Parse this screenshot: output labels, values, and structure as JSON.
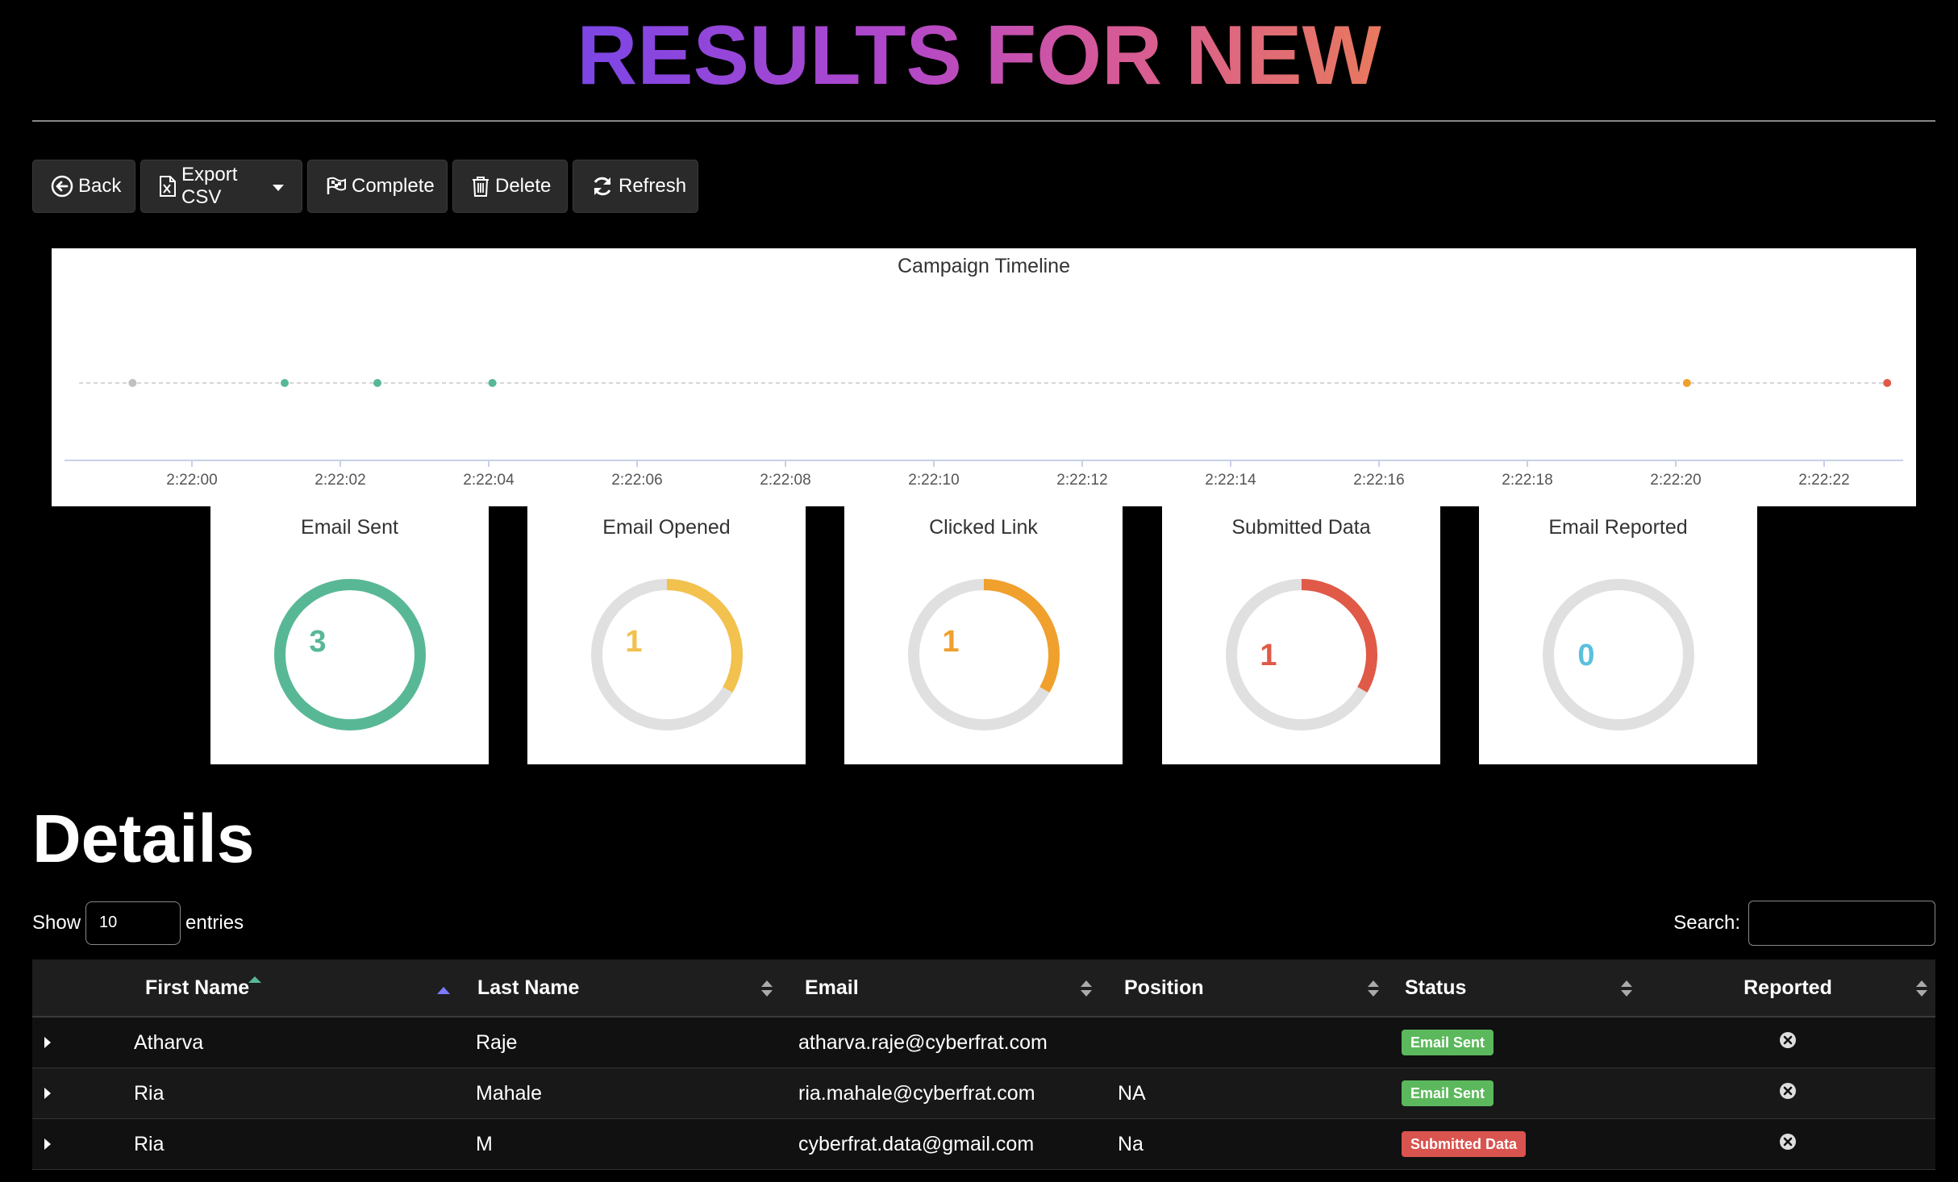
{
  "page": {
    "title": "RESULTS FOR NEW"
  },
  "toolbar": {
    "back_label": "Back",
    "export_label": "Export CSV",
    "complete_label": "Complete",
    "delete_label": "Delete",
    "refresh_label": "Refresh"
  },
  "timeline": {
    "title": "Campaign Timeline",
    "ticks": [
      "2:22:00",
      "2:22:02",
      "2:22:04",
      "2:22:06",
      "2:22:08",
      "2:22:10",
      "2:22:12",
      "2:22:14",
      "2:22:16",
      "2:22:18",
      "2:22:20",
      "2:22:22"
    ],
    "events": [
      {
        "t": -0.8,
        "color": "#c0c0c0"
      },
      {
        "t": 1.25,
        "color": "#58b896"
      },
      {
        "t": 2.5,
        "color": "#58b896"
      },
      {
        "t": 4.05,
        "color": "#58b896"
      },
      {
        "t": 20.15,
        "color": "#f0a02d"
      },
      {
        "t": 22.85,
        "color": "#e05a47"
      }
    ]
  },
  "stats": [
    {
      "label": "Email Sent",
      "value": "3",
      "fraction": 1.0,
      "color": "#58b896"
    },
    {
      "label": "Email Opened",
      "value": "1",
      "fraction": 0.333,
      "color": "#f2c14e"
    },
    {
      "label": "Clicked Link",
      "value": "1",
      "fraction": 0.333,
      "color": "#f0a02d"
    },
    {
      "label": "Submitted Data",
      "value": "1",
      "fraction": 0.333,
      "color": "#e05a47"
    },
    {
      "label": "Email Reported",
      "value": "0",
      "fraction": 0.0,
      "color": "#5bc0de"
    }
  ],
  "details": {
    "heading": "Details",
    "show_label": "Show",
    "entries_value": "10",
    "entries_label": "entries",
    "search_label": "Search:"
  },
  "table": {
    "headers": {
      "first_name": "First Name",
      "last_name": "Last Name",
      "email": "Email",
      "position": "Position",
      "status": "Status",
      "reported": "Reported"
    },
    "rows": [
      {
        "first_name": "Atharva",
        "last_name": "Raje",
        "email": "atharva.raje@cyberfrat.com",
        "position": "",
        "status": "Email Sent",
        "status_color": "#5cb85c"
      },
      {
        "first_name": "Ria",
        "last_name": "Mahale",
        "email": "ria.mahale@cyberfrat.com",
        "position": "NA",
        "status": "Email Sent",
        "status_color": "#5cb85c"
      },
      {
        "first_name": "Ria",
        "last_name": "M",
        "email": "cyberfrat.data@gmail.com",
        "position": "Na",
        "status": "Submitted Data",
        "status_color": "#d9534f"
      }
    ]
  }
}
